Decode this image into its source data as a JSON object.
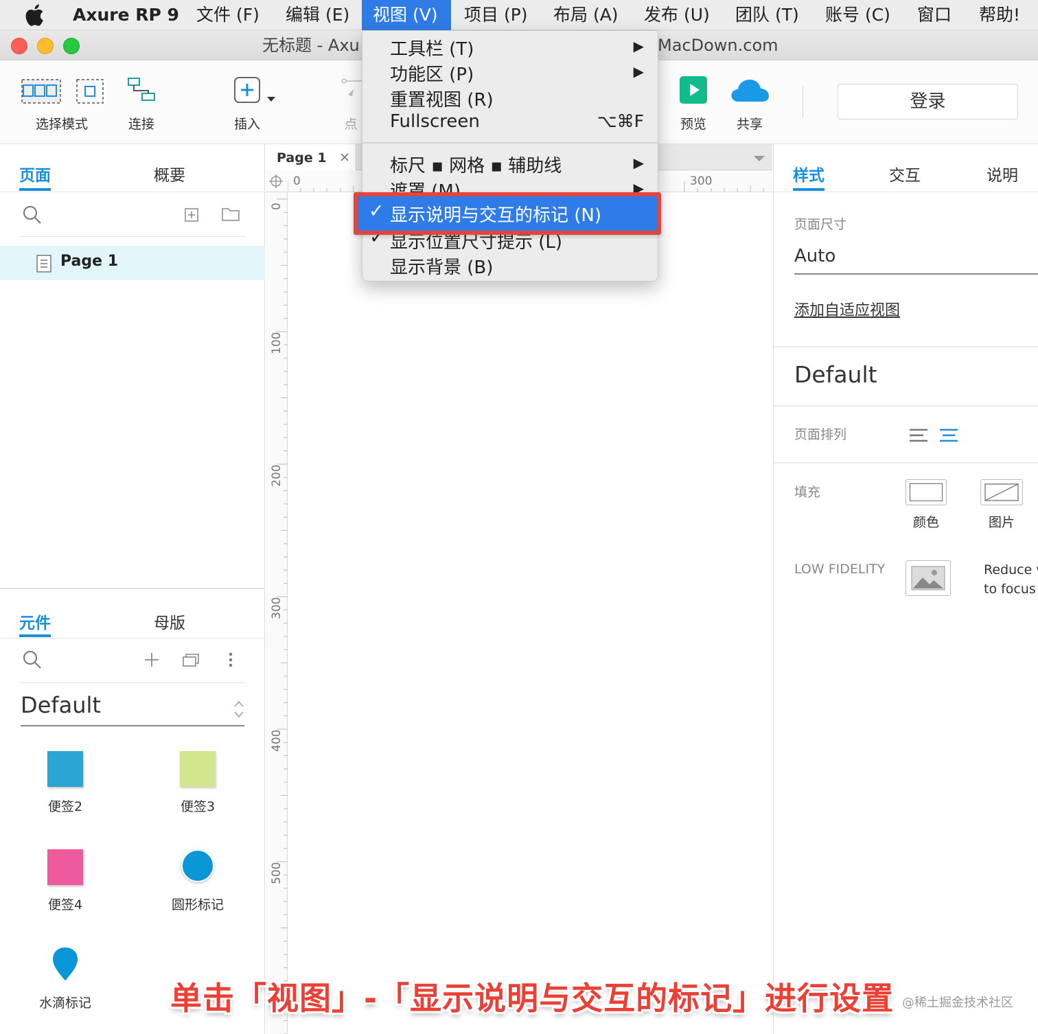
{
  "menubar": {
    "app_name": "Axure RP 9",
    "items": [
      "文件 (F)",
      "编辑 (E)",
      "视图 (V)",
      "项目 (P)",
      "布局 (A)",
      "发布 (U)",
      "团队 (T)",
      "账号 (C)",
      "窗口",
      "帮助!"
    ],
    "active_item": "视图 (V)"
  },
  "window": {
    "title_left": "无标题 - Axu",
    "title_right": "MacDown.com"
  },
  "toolbar": {
    "select_mode": "选择模式",
    "connect": "连接",
    "insert": "插入",
    "point": "点",
    "preview": "预览",
    "share": "共享",
    "login": "登录"
  },
  "view_menu": {
    "items": [
      {
        "label": "工具栏 (T)",
        "submenu": true,
        "shortcut": "",
        "checked": false
      },
      {
        "label": "功能区 (P)",
        "submenu": true,
        "shortcut": "",
        "checked": false
      },
      {
        "label": "重置视图 (R)",
        "submenu": false,
        "shortcut": "",
        "checked": false
      },
      {
        "label": "Fullscreen",
        "submenu": false,
        "shortcut": "⌥⌘F",
        "checked": false
      },
      {
        "label": "标尺 ▪ 网格 ▪ 辅助线",
        "submenu": true,
        "shortcut": "",
        "checked": false
      },
      {
        "label": "遮罩 (M)",
        "submenu": true,
        "shortcut": "",
        "checked": false
      },
      {
        "label": "显示说明与交互的标记 (N)",
        "submenu": false,
        "shortcut": "",
        "checked": true,
        "highlighted": true
      },
      {
        "label": "显示位置尺寸提示 (L)",
        "submenu": false,
        "shortcut": "",
        "checked": true
      },
      {
        "label": "显示背景 (B)",
        "submenu": false,
        "shortcut": "",
        "checked": false
      }
    ],
    "arrow_glyph": "▶",
    "check_glyph": "✓"
  },
  "pages_panel": {
    "tab_pages": "页面",
    "tab_outline": "概要",
    "active_tab": "页面",
    "pages": [
      "Page 1"
    ]
  },
  "library_panel": {
    "tab_widgets": "元件",
    "tab_masters": "母版",
    "active_tab": "元件",
    "library": "Default",
    "widgets": [
      {
        "label": "便签2",
        "color": "#2ba5d3",
        "shape": "square"
      },
      {
        "label": "便签3",
        "color": "#d4e68d",
        "shape": "square"
      },
      {
        "label": "便签4",
        "color": "#ef5a9c",
        "shape": "square"
      },
      {
        "label": "圆形标记",
        "color": "#0b97d7",
        "shape": "circle"
      },
      {
        "label": "水滴标记",
        "color": "#0b97d7",
        "shape": "drop"
      }
    ]
  },
  "canvas": {
    "doc_tab": "Page 1",
    "h_ruler": [
      "0",
      "300"
    ],
    "v_ruler": [
      "0",
      "100",
      "200",
      "300",
      "400",
      "500"
    ]
  },
  "style_panel": {
    "tab_style": "样式",
    "tab_interactions": "交互",
    "tab_notes": "说明",
    "active_tab": "样式",
    "page_size_label": "页面尺寸",
    "page_size_value": "Auto",
    "add_adaptive_view": "添加自适应视图",
    "style_name": "Default",
    "page_align_label": "页面排列",
    "fill_label": "填充",
    "fill_color": "颜色",
    "fill_image": "图片",
    "low_fidelity_label": "LOW FIDELITY",
    "low_fidelity_desc_1": "Reduce v",
    "low_fidelity_desc_2": "to focus o"
  },
  "caption": "单击「视图」-「显示说明与交互的标记」进行设置",
  "watermark": "@稀土掘金技术社区",
  "colors": {
    "accent": "#1a8fdb",
    "menu_highlight": "#2f7ce8",
    "annotation_red": "#e2453c"
  }
}
